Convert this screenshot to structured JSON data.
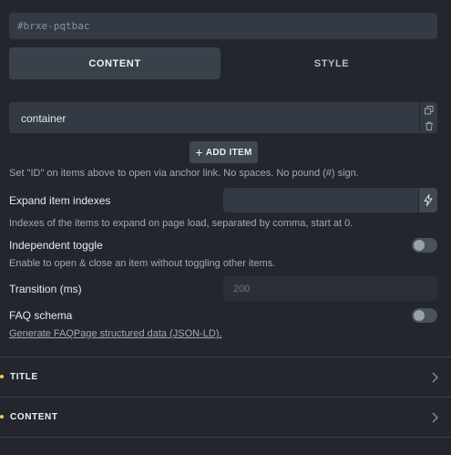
{
  "element_id": {
    "value": "#brxe-pqtbac"
  },
  "tabs": [
    {
      "label": "CONTENT",
      "active": true
    },
    {
      "label": "STYLE",
      "active": false
    }
  ],
  "items": [
    {
      "label": "container"
    }
  ],
  "add_item": {
    "label": "ADD ITEM"
  },
  "items_help": "Set \"ID\" on items above to open via anchor link. No spaces. No pound (#) sign.",
  "expand": {
    "label": "Expand item indexes",
    "value": "",
    "help": "Indexes of the items to expand on page load, separated by comma, start at 0."
  },
  "independent_toggle": {
    "label": "Independent toggle",
    "checked": false,
    "help": "Enable to open & close an item without toggling other items."
  },
  "transition": {
    "label": "Transition (ms)",
    "placeholder": "200"
  },
  "faq": {
    "label": "FAQ schema",
    "checked": false,
    "link": "Generate FAQPage structured data (JSON-LD)."
  },
  "sections": [
    {
      "title": "TITLE"
    },
    {
      "title": "CONTENT"
    }
  ],
  "colors": {
    "background": "#23272d",
    "field": "#333a43",
    "indicator": "#f0d34a"
  },
  "icons": [
    "copy-icon",
    "trash-icon",
    "plus-icon",
    "bolt-icon",
    "chevron-right-icon"
  ]
}
